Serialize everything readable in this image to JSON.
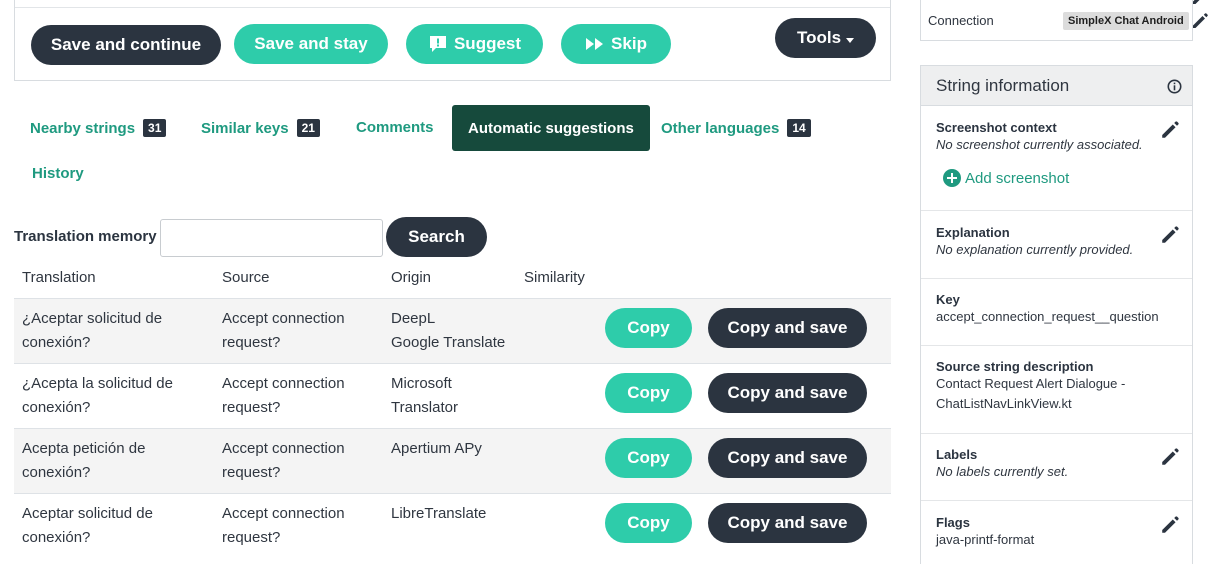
{
  "toolbar": {
    "save_continue": "Save and continue",
    "save_stay": "Save and stay",
    "suggest": "Suggest",
    "skip": "Skip",
    "tools": "Tools"
  },
  "tabs": [
    {
      "label": "Nearby strings",
      "badge": "31"
    },
    {
      "label": "Similar keys",
      "badge": "21"
    },
    {
      "label": "Comments",
      "badge": ""
    },
    {
      "label": "Automatic suggestions",
      "badge": ""
    },
    {
      "label": "Other languages",
      "badge": "14"
    },
    {
      "label": "History",
      "badge": ""
    }
  ],
  "active_tab": "Automatic suggestions",
  "tm": {
    "label": "Translation memory",
    "value": "",
    "search": "Search"
  },
  "table": {
    "headers": [
      "Translation",
      "Source",
      "Origin",
      "Similarity"
    ],
    "copy": "Copy",
    "copy_save": "Copy and save",
    "rows": [
      {
        "translation": [
          "¿Aceptar solicitud de",
          "conexión?"
        ],
        "source": [
          "Accept connection",
          "request?"
        ],
        "origin": [
          "DeepL",
          "Google Translate"
        ]
      },
      {
        "translation": [
          "¿Acepta la solicitud de",
          "conexión?"
        ],
        "source": [
          "Accept connection",
          "request?"
        ],
        "origin": [
          "Microsoft",
          "Translator"
        ]
      },
      {
        "translation": [
          "Acepta petición de",
          "conexión?"
        ],
        "source": [
          "Accept connection",
          "request?"
        ],
        "origin": [
          "Apertium APy"
        ]
      },
      {
        "translation": [
          "Aceptar solicitud de",
          "conexión?"
        ],
        "source": [
          "Accept connection",
          "request?"
        ],
        "origin": [
          "LibreTranslate"
        ]
      }
    ]
  },
  "sidebar": {
    "connection_label": "Connection",
    "connection_badge": "SimpleX Chat Android",
    "panel_title": "String information",
    "screenshot_title": "Screenshot context",
    "screenshot_body": "No screenshot currently associated.",
    "add_screenshot": "Add screenshot",
    "explanation_title": "Explanation",
    "explanation_body": "No explanation currently provided.",
    "key_title": "Key",
    "key_body": "accept_connection_request__question",
    "desc_title": "Source string description",
    "desc_body_1": "Contact Request Alert Dialogue -",
    "desc_body_2": "ChatListNavLinkView.kt",
    "labels_title": "Labels",
    "labels_body": "No labels currently set.",
    "flags_title": "Flags",
    "flags_body": "java-printf-format"
  },
  "colors": {
    "teal": "#2eccaa",
    "dark": "#2b3440",
    "active_tab": "#164a3c",
    "link": "#1f9a80"
  }
}
